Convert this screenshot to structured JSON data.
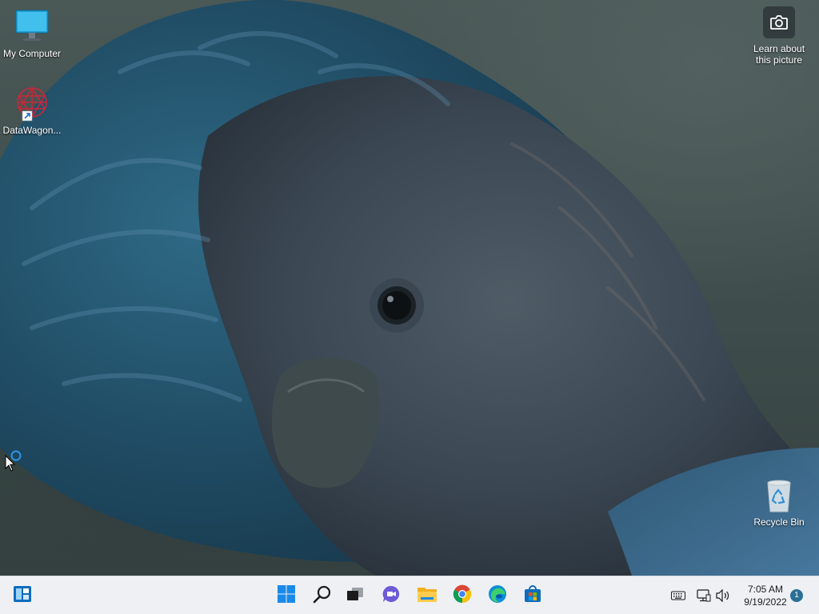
{
  "desktop": {
    "icons": [
      {
        "name": "My Computer",
        "icon": "monitor-icon"
      },
      {
        "name": "DataWagon...",
        "icon": "datawagon-icon"
      },
      {
        "name": "Recycle Bin",
        "icon": "recycle-bin-icon"
      }
    ],
    "learn_about": {
      "line1": "Learn about",
      "line2": "this picture",
      "icon": "camera-icon"
    }
  },
  "taskbar": {
    "left_widget_icon": "widgets-icon",
    "pinned": [
      {
        "name": "Start",
        "icon": "windows-start-icon"
      },
      {
        "name": "Search",
        "icon": "search-icon"
      },
      {
        "name": "Task View",
        "icon": "task-view-icon"
      },
      {
        "name": "Chat",
        "icon": "chat-icon"
      },
      {
        "name": "File Explorer",
        "icon": "folder-icon"
      },
      {
        "name": "Google Chrome",
        "icon": "chrome-icon"
      },
      {
        "name": "Microsoft Edge",
        "icon": "edge-icon"
      },
      {
        "name": "Microsoft Store",
        "icon": "store-icon"
      }
    ],
    "tray": {
      "icons": [
        "keyboard-icon",
        "network-icon",
        "volume-icon"
      ],
      "time": "7:05 AM",
      "date": "9/19/2022",
      "notification_count": "1"
    }
  },
  "colors": {
    "taskbar_bg": "#eef0f4",
    "accent_blue": "#0078d4"
  }
}
